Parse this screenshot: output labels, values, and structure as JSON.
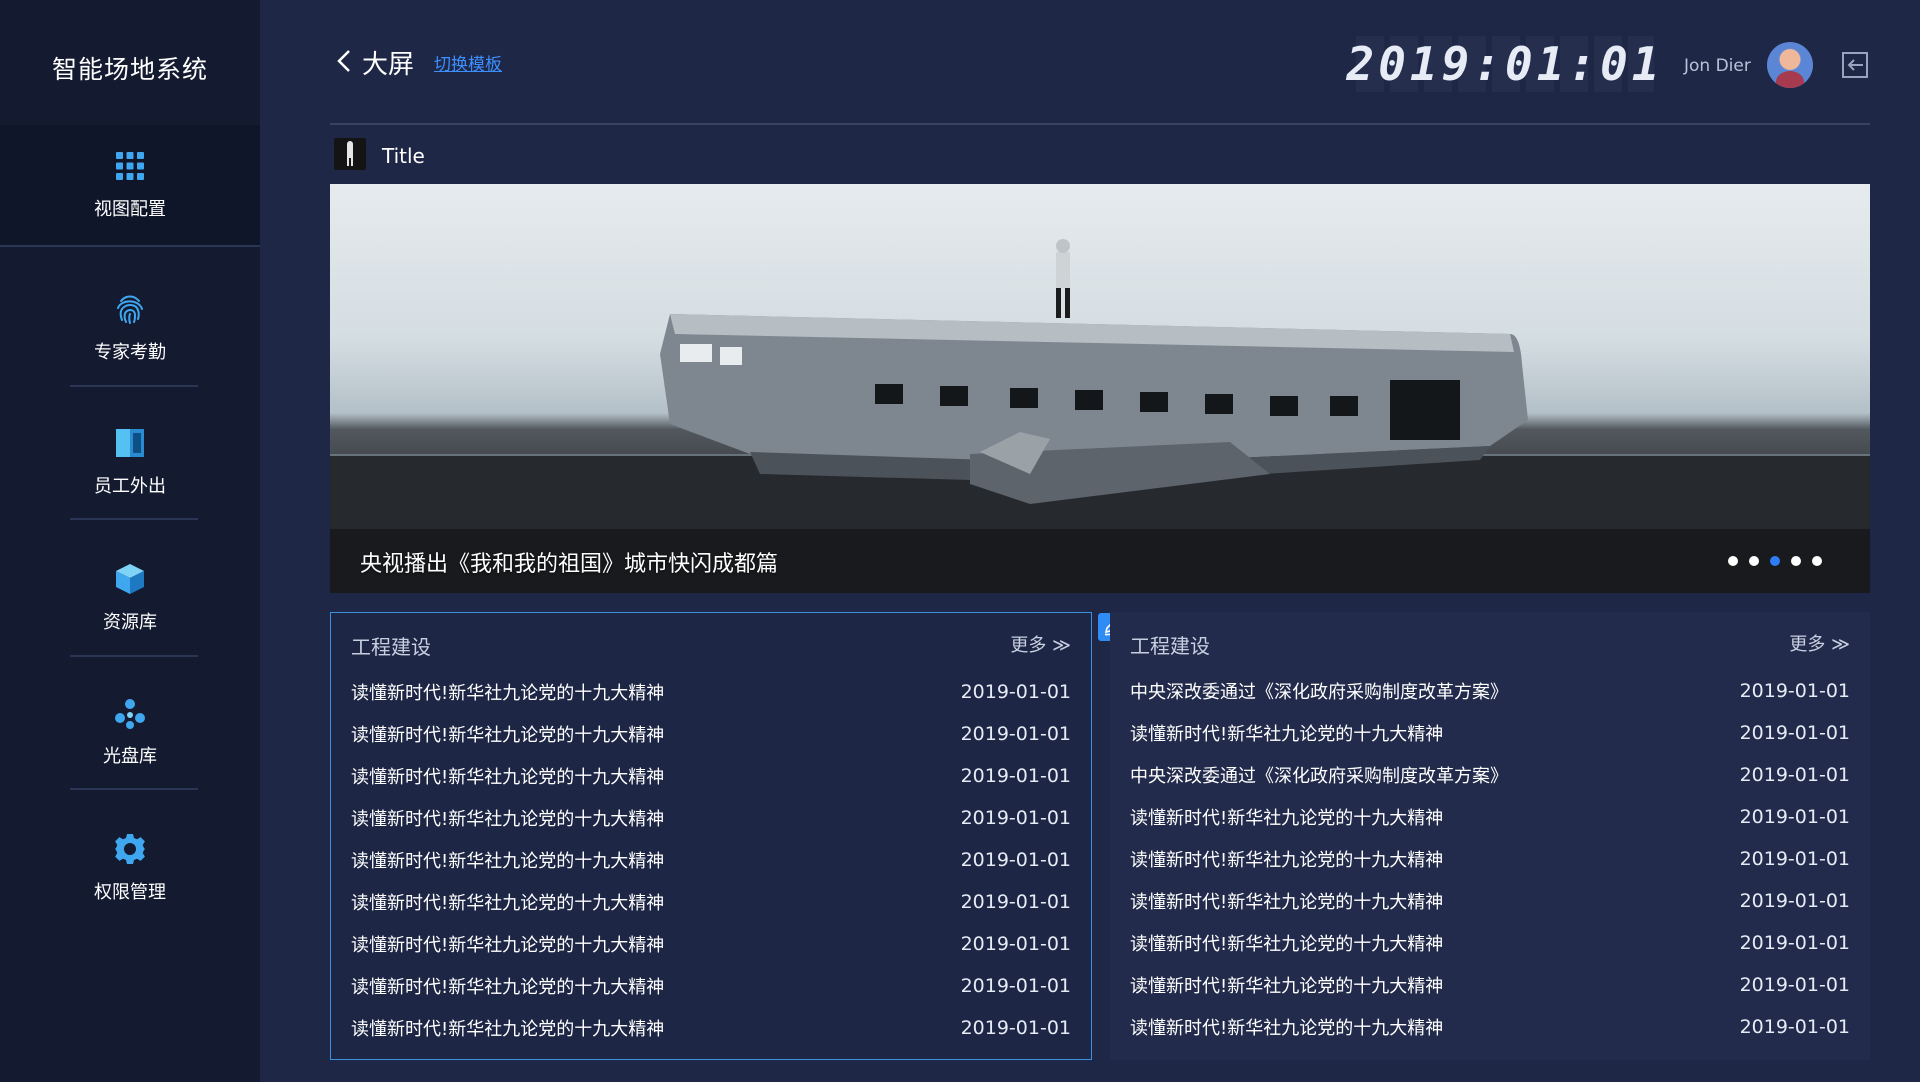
{
  "app": {
    "title": "智能场地系统"
  },
  "sidebar": {
    "items": [
      {
        "label": "视图配置",
        "icon": "grid-icon",
        "active": true
      },
      {
        "label": "专家考勤",
        "icon": "fingerprint-icon"
      },
      {
        "label": "员工外出",
        "icon": "panel-icon"
      },
      {
        "label": "资源库",
        "icon": "cube-icon"
      },
      {
        "label": "光盘库",
        "icon": "molecule-icon"
      },
      {
        "label": "权限管理",
        "icon": "gear-icon"
      }
    ]
  },
  "header": {
    "title": "大屏",
    "switch_label": "切换模板",
    "clock": "2019:01:01",
    "user_name": "Jon Dier"
  },
  "section": {
    "title": "Title"
  },
  "banner": {
    "caption": "央视播出《我和我的祖国》城市快闪成都篇",
    "dot_count": 5,
    "active_dot": 3
  },
  "panels": [
    {
      "title": "工程建设",
      "more": "更多 ≫",
      "items": [
        {
          "text": "读懂新时代!新华社九论党的十九大精神",
          "date": "2019-01-01"
        },
        {
          "text": "读懂新时代!新华社九论党的十九大精神",
          "date": "2019-01-01"
        },
        {
          "text": "读懂新时代!新华社九论党的十九大精神",
          "date": "2019-01-01"
        },
        {
          "text": "读懂新时代!新华社九论党的十九大精神",
          "date": "2019-01-01"
        },
        {
          "text": "读懂新时代!新华社九论党的十九大精神",
          "date": "2019-01-01"
        },
        {
          "text": "读懂新时代!新华社九论党的十九大精神",
          "date": "2019-01-01"
        },
        {
          "text": "读懂新时代!新华社九论党的十九大精神",
          "date": "2019-01-01"
        },
        {
          "text": "读懂新时代!新华社九论党的十九大精神",
          "date": "2019-01-01"
        },
        {
          "text": "读懂新时代!新华社九论党的十九大精神",
          "date": "2019-01-01"
        }
      ]
    },
    {
      "title": "工程建设",
      "more": "更多 ≫",
      "items": [
        {
          "text": "中央深改委通过《深化政府采购制度改革方案》",
          "date": "2019-01-01"
        },
        {
          "text": "读懂新时代!新华社九论党的十九大精神",
          "date": "2019-01-01"
        },
        {
          "text": "中央深改委通过《深化政府采购制度改革方案》",
          "date": "2019-01-01"
        },
        {
          "text": "读懂新时代!新华社九论党的十九大精神",
          "date": "2019-01-01"
        },
        {
          "text": "读懂新时代!新华社九论党的十九大精神",
          "date": "2019-01-01"
        },
        {
          "text": "读懂新时代!新华社九论党的十九大精神",
          "date": "2019-01-01"
        },
        {
          "text": "读懂新时代!新华社九论党的十九大精神",
          "date": "2019-01-01"
        },
        {
          "text": "读懂新时代!新华社九论党的十九大精神",
          "date": "2019-01-01"
        },
        {
          "text": "读懂新时代!新华社九论党的十九大精神",
          "date": "2019-01-01"
        }
      ]
    }
  ],
  "colors": {
    "background": "#1e2746",
    "sidebar": "#141b31",
    "accent": "#2f7cf6",
    "link": "#3d8fff",
    "panel_border": "#3d8fe0"
  }
}
